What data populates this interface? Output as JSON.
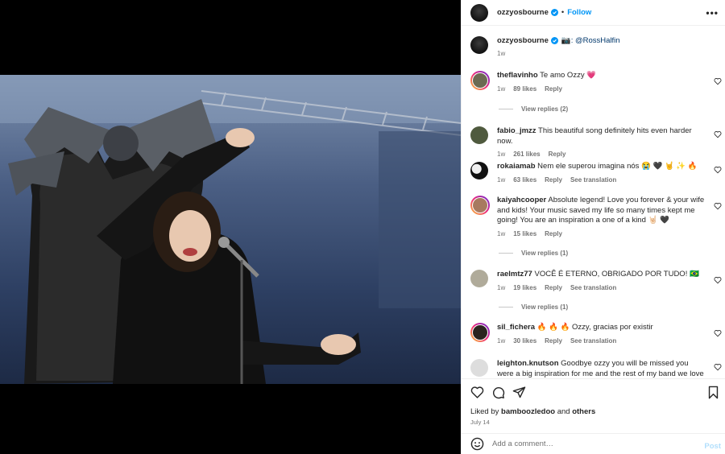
{
  "header": {
    "username": "ozzyosbourne",
    "separator": "•",
    "follow_label": "Follow",
    "more_label": "•••"
  },
  "caption": {
    "username": "ozzyosbourne",
    "camera_emoji": "📷",
    "credit": ": @RossHalfin",
    "time": "1w"
  },
  "comments": [
    {
      "user": "theflavinho",
      "text": "Te amo Ozzy 💗",
      "time": "1w",
      "likes": "89 likes",
      "reply": "Reply",
      "translation": "",
      "view_replies": "View replies (2)"
    },
    {
      "user": "fabio_jmzz",
      "text": "This beautiful song definitely hits even harder now.",
      "time": "1w",
      "likes": "261 likes",
      "reply": "Reply",
      "translation": "",
      "view_replies": ""
    },
    {
      "user": "rokaiamab",
      "text": "Nem ele superou imagina nós 😭 🖤 🤘 ✨ 🔥",
      "time": "1w",
      "likes": "63 likes",
      "reply": "Reply",
      "translation": "See translation",
      "view_replies": ""
    },
    {
      "user": "kaiyahcooper",
      "text": "Absolute legend! Love you forever & your wife and kids! Your music saved my life so many times kept me going! You are an inspiration a one of a kind 🤘🏻 🖤",
      "time": "1w",
      "likes": "15 likes",
      "reply": "Reply",
      "translation": "",
      "view_replies": "View replies (1)"
    },
    {
      "user": "raelmtz77",
      "text": "VOCÊ É ETERNO, OBRIGADO POR TUDO! 🇧🇷",
      "time": "1w",
      "likes": "19 likes",
      "reply": "Reply",
      "translation": "See translation",
      "view_replies": "View replies (1)"
    },
    {
      "user": "sil_fichera",
      "text": "🔥 🔥 🔥 Ozzy, gracias por existir",
      "time": "1w",
      "likes": "30 likes",
      "reply": "Reply",
      "translation": "See translation",
      "view_replies": ""
    },
    {
      "user": "leighton.knutson",
      "text": "Goodbye ozzy you will be missed you were a big inspiration for me and the rest of my band we love you",
      "time": "",
      "likes": "",
      "reply": "",
      "translation": "",
      "view_replies": ""
    }
  ],
  "liked_by": {
    "prefix": "Liked by",
    "user": "bamboozledoo",
    "and": "and",
    "others": "others"
  },
  "date": "July 14",
  "add_comment": {
    "placeholder": "Add a comment…",
    "post_label": "Post"
  },
  "colors": {
    "accent": "#0095f6",
    "post_disabled": "#b2dffc",
    "secondary_text": "#737373"
  }
}
